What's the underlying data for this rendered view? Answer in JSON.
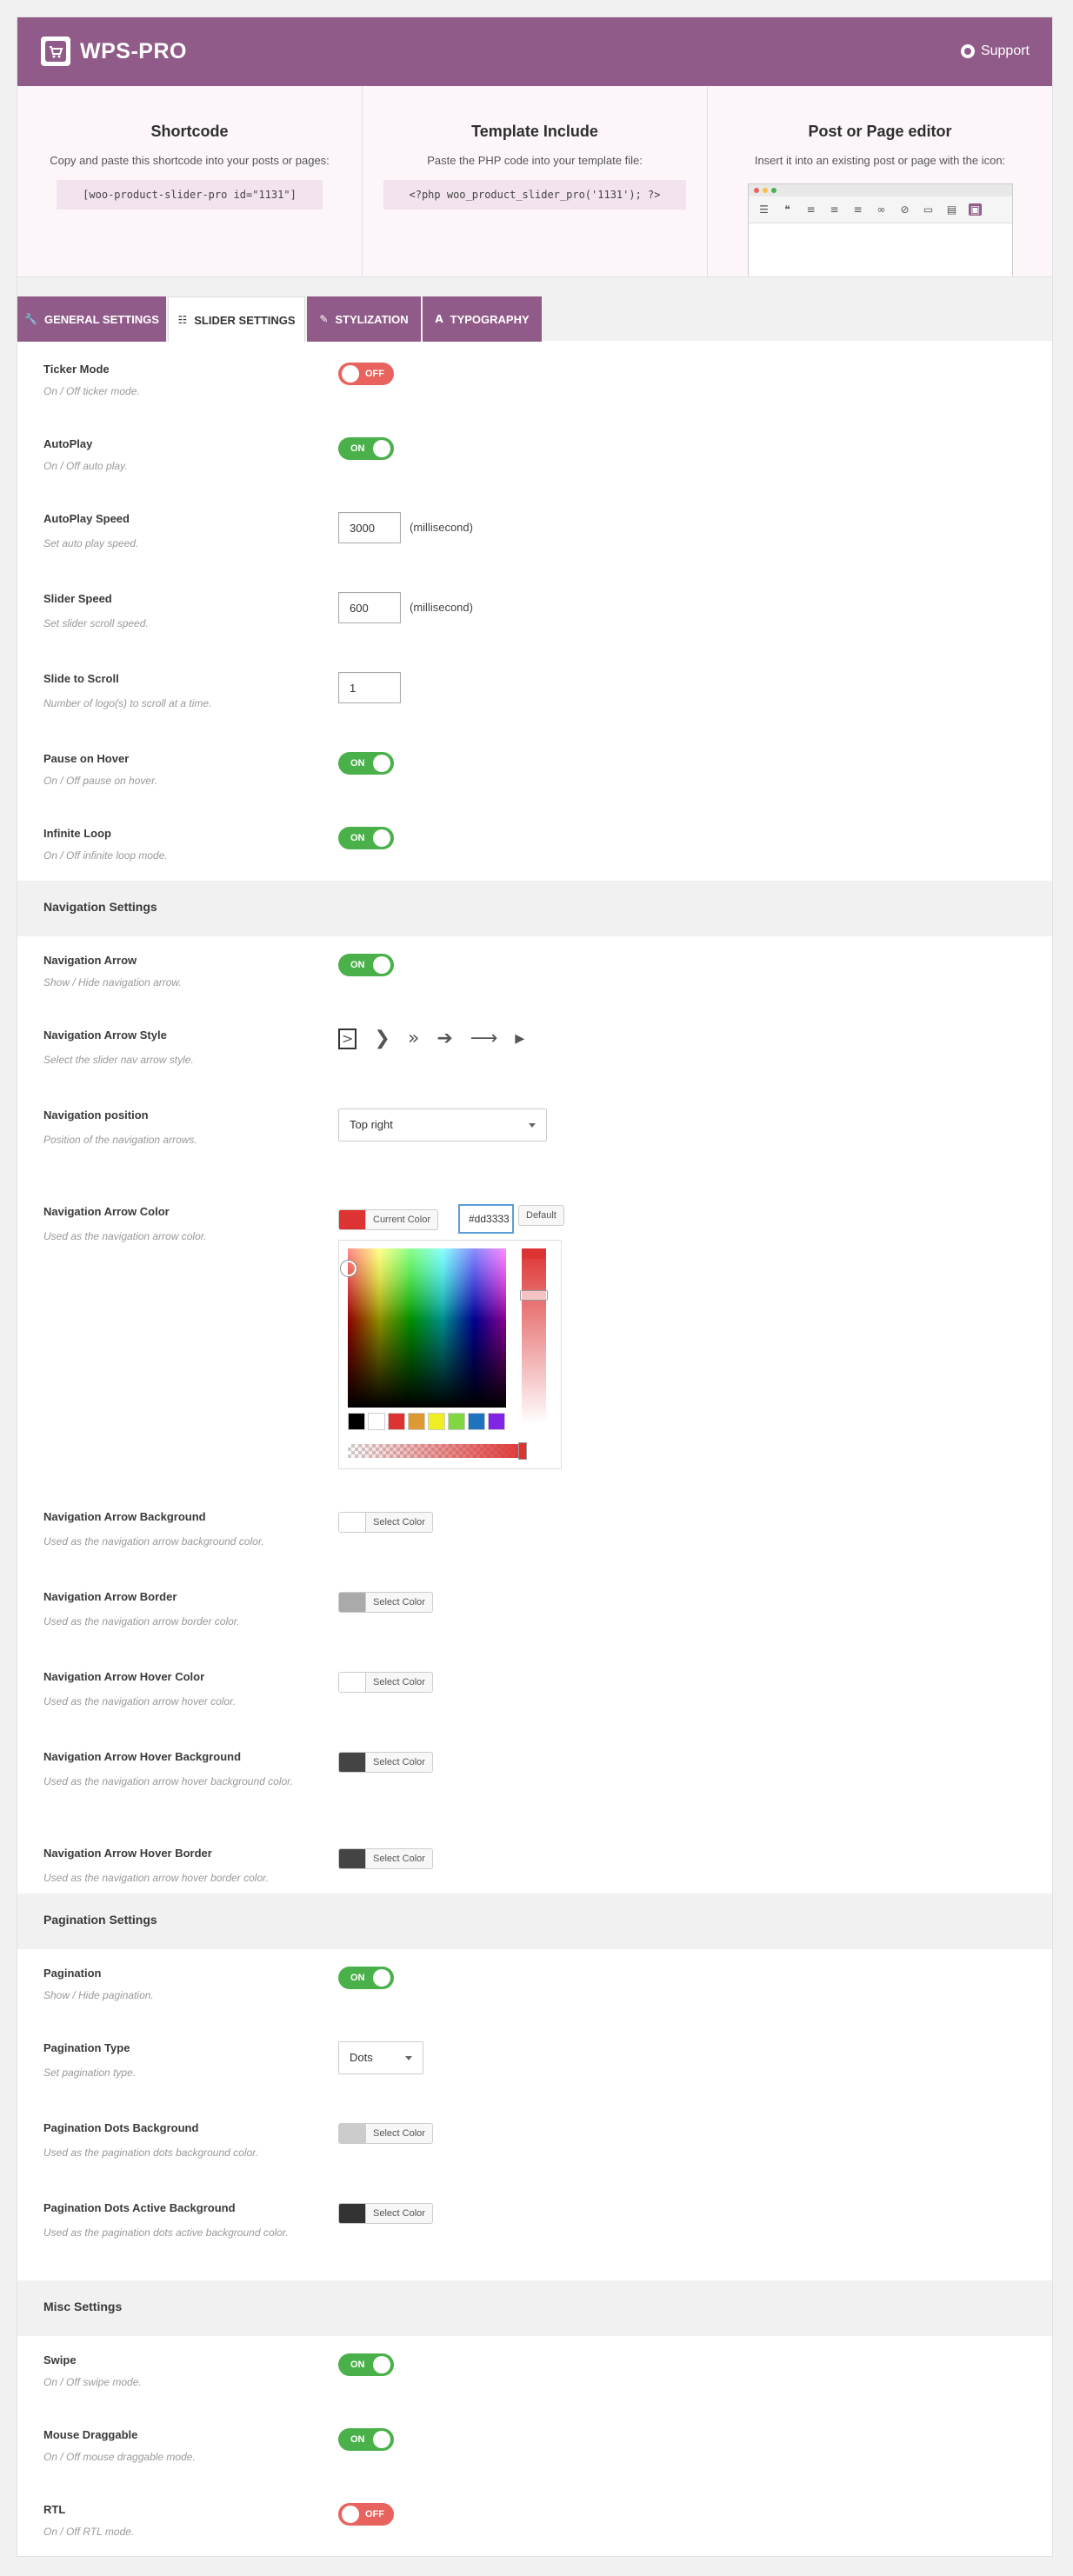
{
  "brand": "WPS-PRO",
  "support_label": "Support",
  "info": [
    {
      "title": "Shortcode",
      "text": "Copy and paste this shortcode into your posts or pages:",
      "code": "[woo-product-slider-pro id=\"1131\"]"
    },
    {
      "title": "Template Include",
      "text": "Paste the PHP code into your template file:",
      "code": "<?php woo_product_slider_pro('1131'); ?>"
    },
    {
      "title": "Post or Page editor",
      "text": "Insert it into an existing post or page with the icon:"
    }
  ],
  "tabs": [
    {
      "label": "General Settings",
      "icon": "wrench-icon",
      "active": false
    },
    {
      "label": "Slider Settings",
      "icon": "sliders-icon",
      "active": true
    },
    {
      "label": "Stylization",
      "icon": "brush-icon",
      "active": false
    },
    {
      "label": "Typography",
      "icon": "font-icon",
      "active": false
    }
  ],
  "toggle_on": "ON",
  "toggle_off": "OFF",
  "fields": {
    "ticker_mode": {
      "label": "Ticker Mode",
      "desc": "On / Off ticker mode.",
      "state": "OFF"
    },
    "autoplay": {
      "label": "AutoPlay",
      "desc": "On / Off auto play.",
      "state": "ON"
    },
    "autoplay_speed": {
      "label": "AutoPlay Speed",
      "desc": "Set auto play speed.",
      "value": "3000",
      "unit": "(millisecond)"
    },
    "slider_speed": {
      "label": "Slider Speed",
      "desc": "Set slider scroll speed.",
      "value": "600",
      "unit": "(millisecond)"
    },
    "slide_to_scroll": {
      "label": "Slide to Scroll",
      "desc": "Number of logo(s) to scroll at a time.",
      "value": "1"
    },
    "pause_on_hover": {
      "label": "Pause on Hover",
      "desc": "On / Off pause on hover.",
      "state": "ON"
    },
    "infinite_loop": {
      "label": "Infinite Loop",
      "desc": "On / Off infinite loop mode.",
      "state": "ON"
    },
    "nav_arrow": {
      "label": "Navigation Arrow",
      "desc": "Show / Hide navigation arrow.",
      "state": "ON"
    },
    "nav_arrow_style": {
      "label": "Navigation Arrow Style",
      "desc": "Select the slider nav arrow style."
    },
    "nav_position": {
      "label": "Navigation position",
      "desc": "Position of the navigation arrows.",
      "value": "Top right"
    },
    "nav_arrow_color": {
      "label": "Navigation Arrow Color",
      "desc": "Used as the navigation arrow color.",
      "button": "Current Color",
      "hex": "#dd3333",
      "default": "Default",
      "color": "#dd3333"
    },
    "nav_arrow_bg": {
      "label": "Navigation Arrow Background",
      "desc": "Used as the navigation arrow background color.",
      "button": "Select Color",
      "color": "#ffffff"
    },
    "nav_arrow_border": {
      "label": "Navigation Arrow Border",
      "desc": "Used as the navigation arrow border color.",
      "button": "Select Color",
      "color": "#aaaaaa"
    },
    "nav_arrow_hover_color": {
      "label": "Navigation Arrow Hover Color",
      "desc": "Used as the navigation arrow hover color.",
      "button": "Select Color",
      "color": "#ffffff"
    },
    "nav_arrow_hover_bg": {
      "label": "Navigation Arrow Hover Background",
      "desc": "Used as the navigation arrow hover background color.",
      "button": "Select Color",
      "color": "#444444"
    },
    "nav_arrow_hover_border": {
      "label": "Navigation Arrow Hover Border",
      "desc": "Used as the navigation arrow hover border color.",
      "button": "Select Color",
      "color": "#444444"
    },
    "pagination": {
      "label": "Pagination",
      "desc": "Show / Hide pagination.",
      "state": "ON"
    },
    "pagination_type": {
      "label": "Pagination Type",
      "desc": "Set pagination type.",
      "value": "Dots"
    },
    "dots_bg": {
      "label": "Pagination Dots Background",
      "desc": "Used as the pagination dots background color.",
      "button": "Select Color",
      "color": "#cccccc"
    },
    "dots_active_bg": {
      "label": "Pagination Dots Active Background",
      "desc": "Used as the pagination dots active background color.",
      "button": "Select Color",
      "color": "#333333"
    },
    "swipe": {
      "label": "Swipe",
      "desc": "On / Off swipe mode.",
      "state": "ON"
    },
    "mouse_draggable": {
      "label": "Mouse Draggable",
      "desc": "On / Off mouse draggable mode.",
      "state": "ON"
    },
    "rtl": {
      "label": "RTL",
      "desc": "On / Off RTL mode.",
      "state": "OFF"
    }
  },
  "sections": {
    "navigation": "Navigation Settings",
    "pagination": "Pagination Settings",
    "misc": "Misc Settings"
  },
  "palette": [
    "#000000",
    "#ffffff",
    "#dd3333",
    "#dd9933",
    "#eeee22",
    "#81d742",
    "#1e73be",
    "#8224e3"
  ]
}
